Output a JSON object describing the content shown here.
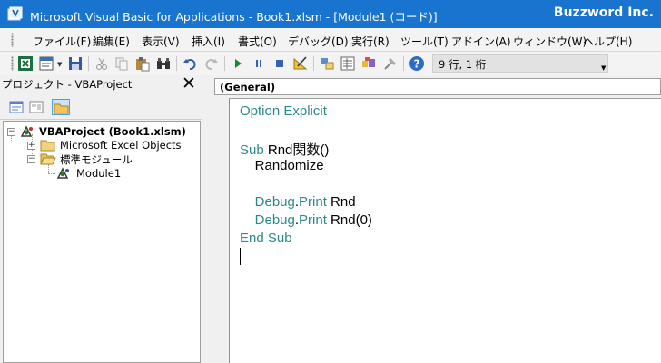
{
  "window": {
    "title": "Microsoft Visual Basic for Applications - Book1.xlsm - [Module1 (コード)]",
    "brand": "Buzzword Inc."
  },
  "menu": [
    {
      "label": "ファイル(F)"
    },
    {
      "label": "編集(E)"
    },
    {
      "label": "表示(V)"
    },
    {
      "label": "挿入(I)"
    },
    {
      "label": "書式(O)"
    },
    {
      "label": "デバッグ(D)"
    },
    {
      "label": "実行(R)"
    },
    {
      "label": "ツール(T)"
    },
    {
      "label": "アドイン(A)"
    },
    {
      "label": "ウィンドウ(W)"
    },
    {
      "label": "ヘルプ(H)"
    }
  ],
  "toolbar": {
    "icons": [
      "excel-view-icon",
      "insert-module-icon",
      "save-icon",
      "cut-icon",
      "copy-icon",
      "paste-icon",
      "find-icon",
      "undo-icon",
      "redo-icon",
      "run-icon",
      "break-icon",
      "reset-icon",
      "design-mode-icon",
      "project-explorer-icon",
      "properties-icon",
      "object-browser-icon",
      "toolbox-icon",
      "help-icon"
    ],
    "position": "9 行, 1 桁"
  },
  "project_pane": {
    "title": "プロジェクト - VBAProject",
    "close": "✕",
    "tree": {
      "root": "VBAProject (Book1.xlsm)",
      "excel_objects": "Microsoft Excel Objects",
      "modules_folder": "標準モジュール",
      "module": "Module1"
    }
  },
  "code_pane": {
    "object_combo": "(General)",
    "lines": {
      "l1_kw": "Option Explicit",
      "l3_kw": "Sub",
      "l3_rest": " Rnd関数()",
      "l4": "    Randomize",
      "l6_kw1": "    Debug",
      "l6_dot": ".",
      "l6_kw2": "Print",
      "l6_rest": " Rnd",
      "l7_kw1": "    Debug",
      "l7_dot": ".",
      "l7_kw2": "Print",
      "l7_rest": " Rnd(0)",
      "l8_kw": "End Sub"
    }
  },
  "colors": {
    "titlebar": "#1874cf",
    "keyword": "#2a8a8a"
  }
}
